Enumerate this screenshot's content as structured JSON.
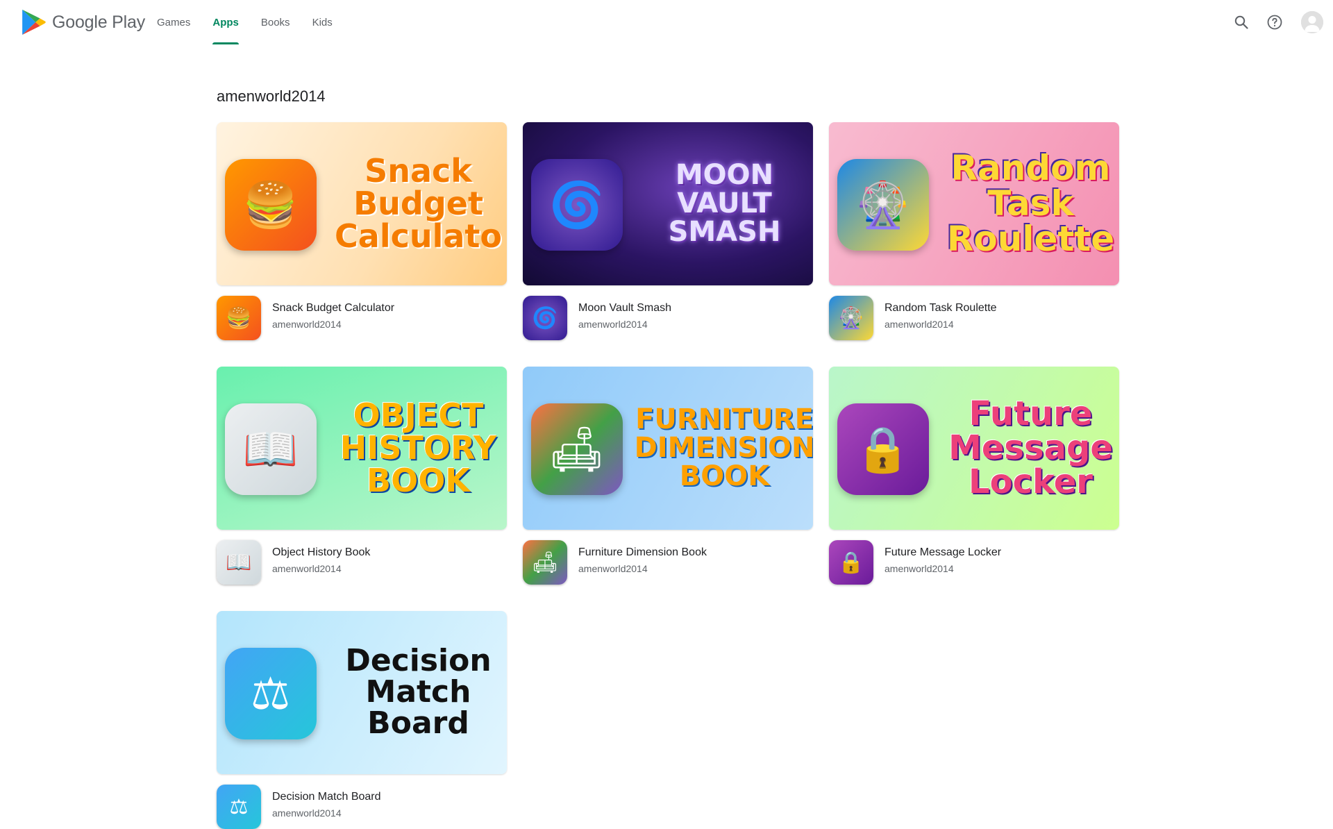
{
  "header": {
    "logo_text": "Google Play",
    "tabs": [
      {
        "label": "Games"
      },
      {
        "label": "Apps"
      },
      {
        "label": "Books"
      },
      {
        "label": "Kids"
      }
    ],
    "active_tab": "Apps",
    "accent_color": "#01875f",
    "icons": [
      "search-icon",
      "help-icon",
      "account-avatar"
    ]
  },
  "page": {
    "title": "amenworld2014"
  },
  "apps": [
    {
      "name": "Snack Budget Calculator",
      "developer": "amenworld2014",
      "banner_text": "Snack Budget\nCalculato",
      "icon_glyph": "🍔"
    },
    {
      "name": "Moon Vault Smash",
      "developer": "amenworld2014",
      "banner_text": "MOON VAULT SMASH",
      "icon_glyph": "🌀"
    },
    {
      "name": "Random Task Roulette",
      "developer": "amenworld2014",
      "banner_text": "Random\nTask\nRoulette",
      "icon_glyph": "🎡"
    },
    {
      "name": "Object History Book",
      "developer": "amenworld2014",
      "banner_text": "OBJECT\nHISTORY\nBOOK",
      "icon_glyph": "📖"
    },
    {
      "name": "Furniture Dimension Book",
      "developer": "amenworld2014",
      "banner_text": "FURNITURE\nDIMENSION\nBOOK",
      "icon_glyph": "🛋"
    },
    {
      "name": "Future Message Locker",
      "developer": "amenworld2014",
      "banner_text": "Future\nMessage\nLocker",
      "icon_glyph": "🔒"
    },
    {
      "name": "Decision Match Board",
      "developer": "amenworld2014",
      "banner_text": "Decision\nMatch Board",
      "icon_glyph": "⚖"
    }
  ]
}
